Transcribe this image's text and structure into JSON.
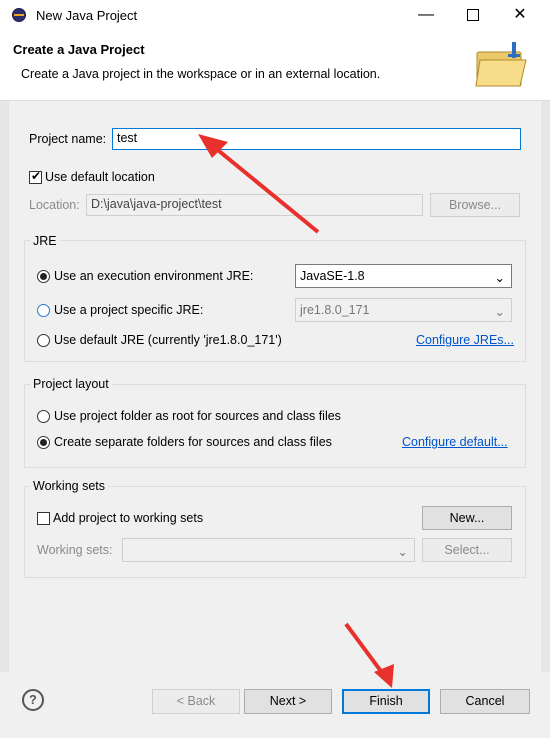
{
  "window": {
    "title": "New Java Project"
  },
  "banner": {
    "title": "Create a Java Project",
    "description": "Create a Java project in the workspace or in an external location."
  },
  "project_name": {
    "label": "Project name:",
    "value": "test"
  },
  "location": {
    "use_default_label": "Use default location",
    "use_default_checked": true,
    "label": "Location:",
    "value": "D:\\java\\java-project\\test",
    "browse_label": "Browse..."
  },
  "jre": {
    "title": "JRE",
    "option_env_label": "Use an execution environment JRE:",
    "option_env_value": "JavaSE-1.8",
    "option_specific_label": "Use a project specific JRE:",
    "option_specific_value": "jre1.8.0_171",
    "option_default_label": "Use default JRE (currently 'jre1.8.0_171')",
    "configure_link": "Configure JREs...",
    "selected": "env"
  },
  "layout": {
    "title": "Project layout",
    "option_root_label": "Use project folder as root for sources and class files",
    "option_separate_label": "Create separate folders for sources and class files",
    "configure_link": "Configure default...",
    "selected": "separate"
  },
  "working_sets": {
    "title": "Working sets",
    "add_label": "Add project to working sets",
    "add_checked": false,
    "new_button": "New...",
    "field_label": "Working sets:",
    "select_button": "Select..."
  },
  "footer": {
    "help_symbol": "?",
    "back_button": "< Back",
    "next_button": "Next >",
    "finish_button": "Finish",
    "cancel_button": "Cancel"
  },
  "colors": {
    "accent": "#0078d7",
    "link": "#0055cc",
    "annotation_arrow": "#e8302c"
  }
}
